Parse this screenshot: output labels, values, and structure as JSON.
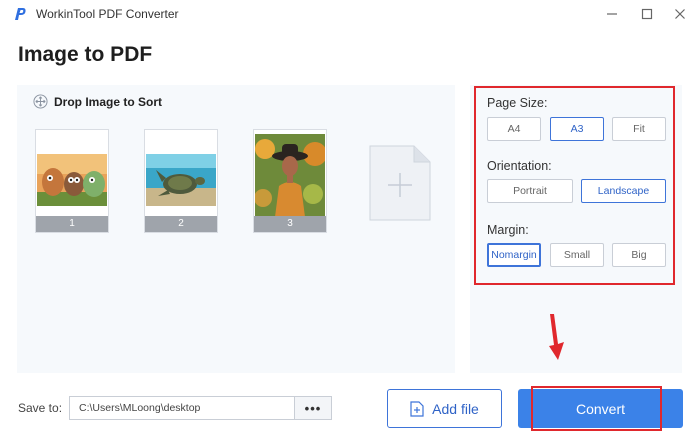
{
  "window": {
    "app_title": "WorkinTool PDF Converter",
    "controls": [
      "minimize",
      "maximize",
      "close"
    ]
  },
  "page": {
    "title": "Image to PDF"
  },
  "drop_area": {
    "label": "Drop Image to Sort",
    "images": [
      {
        "number": "1",
        "icon": "animated-characters-image"
      },
      {
        "number": "2",
        "icon": "sea-turtle-image"
      },
      {
        "number": "3",
        "icon": "woman-portrait-image"
      }
    ],
    "add_icon": "plus-page-icon"
  },
  "settings": {
    "page_size": {
      "label": "Page Size:",
      "options": [
        "A4",
        "A3",
        "Fit"
      ],
      "selected": "A3"
    },
    "orientation": {
      "label": "Orientation:",
      "options": [
        "Portrait",
        "Landscape"
      ],
      "selected": "Landscape"
    },
    "margin": {
      "label": "Margin:",
      "options": [
        "Nomargin",
        "Small",
        "Big"
      ],
      "selected": "Nomargin"
    }
  },
  "bottom": {
    "save_label": "Save to:",
    "save_path": "C:\\Users\\MLoong\\desktop",
    "browse_label": "•••",
    "add_file_label": "Add file",
    "convert_label": "Convert"
  },
  "colors": {
    "accent": "#3b82e8",
    "highlight": "#e0282d",
    "panel_bg": "#f6f9fc"
  }
}
